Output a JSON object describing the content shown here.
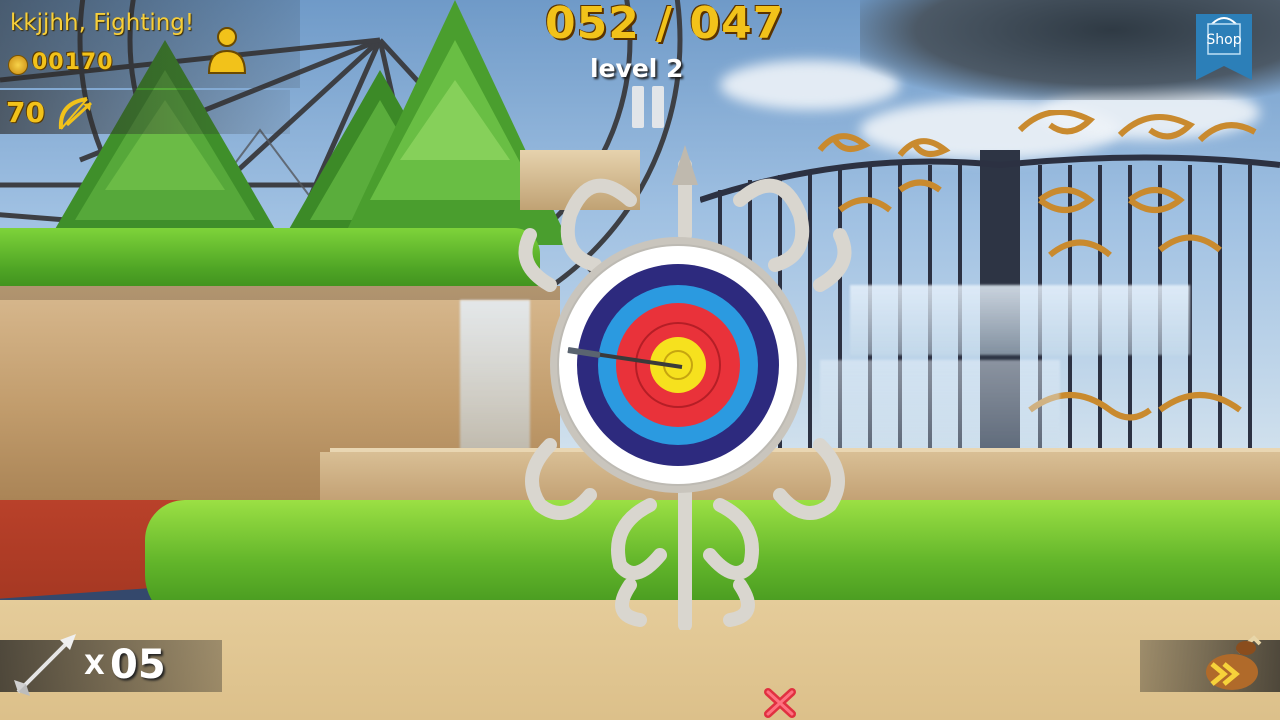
{
  "player": {
    "name": "kkjjhh, Fighting!",
    "coins": "00170",
    "bow_power": "70",
    "avatar_icon": "avatar-icon",
    "coin_icon": "coin-icon",
    "bow_icon": "bow-icon"
  },
  "score": {
    "text": "052 / 047",
    "current": 52,
    "target": 47
  },
  "level": {
    "text": "level 2"
  },
  "controls": {
    "pause_icon": "pause-icon",
    "shop_label": "Shop"
  },
  "arrows": {
    "prefix": "X",
    "count": "05",
    "icon": "arrow-icon"
  },
  "quiver": {
    "icon": "quiver-icon"
  },
  "miss_marker": {
    "icon": "red-x-icon"
  },
  "target": {
    "ring_colors": [
      "#ffffff",
      "#2d2a7e",
      "#2b9ae0",
      "#e9323a",
      "#f6e11e"
    ],
    "frame_color": "#d9d6cf",
    "arrow_in_target": true
  },
  "colors": {
    "hud_gold": "#f2c21a",
    "shop_blue": "#2c7fb8"
  }
}
